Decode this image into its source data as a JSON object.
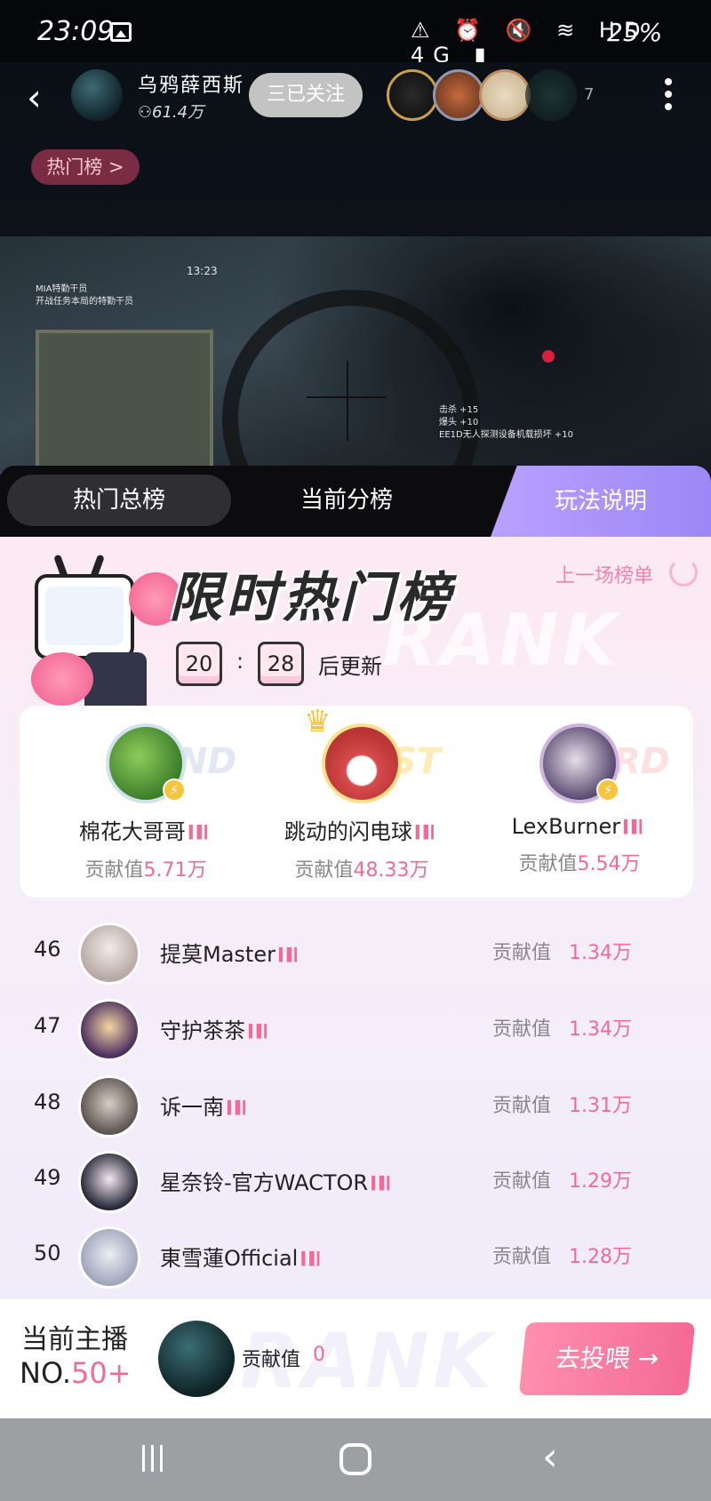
{
  "status_bar": {
    "time": "23:09",
    "system_icons": "⚠ ⏰ 🔇 ≋ HD 4G ▮",
    "battery": "25%"
  },
  "live_header": {
    "streamer_name": "乌鸦薛西斯",
    "fans": "61.4万",
    "follow_label": "三已关注",
    "viewer_count": "7",
    "hot_rank_chip": "热门榜 >"
  },
  "video_hud": {
    "timer": "13:23",
    "line1": "MIA特勤干员",
    "line2": "开战任务本局的特勤干员",
    "kill1": "击杀 +15",
    "kill2": "爆头 +10",
    "kill3": "EE1D无人探测设备机载损坏 +10"
  },
  "tabs": [
    {
      "label": "热门总榜"
    },
    {
      "label": "当前分榜"
    },
    {
      "label": "玩法说明"
    }
  ],
  "banner": {
    "title": "限时热门榜",
    "prev_rank_label": "上一场榜单",
    "watermark": "RANK",
    "timer_hours": "20",
    "timer_sep": ":",
    "timer_minutes": "28",
    "timer_suffix": "后更新"
  },
  "podium": {
    "marks": [
      "2ND",
      "1ST",
      "3RD"
    ],
    "second": {
      "name": "棉花大哥哥",
      "score_label": "贡献值",
      "score": "5.71万"
    },
    "first": {
      "name": "跳动的闪电球",
      "score_label": "贡献值",
      "score": "48.33万"
    },
    "third": {
      "name": "LexBurner",
      "score_label": "贡献值",
      "score": "5.54万"
    }
  },
  "ranking_list": [
    {
      "rank": "46",
      "name": "提莫Master",
      "score_label": "贡献值",
      "score": "1.34万"
    },
    {
      "rank": "47",
      "name": "守护茶茶",
      "score_label": "贡献值",
      "score": "1.34万"
    },
    {
      "rank": "48",
      "name": "诉一南",
      "score_label": "贡献值",
      "score": "1.31万"
    },
    {
      "rank": "49",
      "name": "星奈铃-官方WACTOR",
      "score_label": "贡献值",
      "score": "1.29万"
    },
    {
      "rank": "50",
      "name": "東雪蓮Official",
      "score_label": "贡献值",
      "score": "1.28万"
    }
  ],
  "bottom": {
    "current_label": "当前主播",
    "rank_prefix": "NO.",
    "rank_value": "50+",
    "score_label": "贡献值",
    "score": "0",
    "vote_label": "去投喂 →",
    "watermark": "RANK"
  },
  "icons": {
    "back": "back-arrow-icon",
    "more": "more-vertical-icon",
    "refresh": "refresh-icon",
    "crown": "crown-icon",
    "bolt": "lightning-badge-icon"
  },
  "colors": {
    "accent_pink": "#f06b95",
    "rules_tab": "#a892f8",
    "panel_bg": "#fde9f2"
  }
}
